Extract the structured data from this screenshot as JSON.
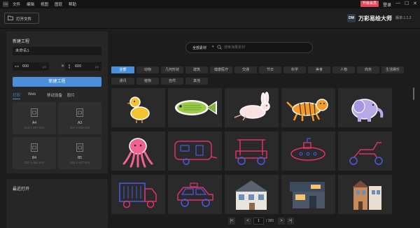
{
  "menubar": {
    "logo": "DM",
    "items": [
      "文件",
      "编辑",
      "视图",
      "图层",
      "帮助"
    ],
    "pro_badge": "升级会员",
    "login": "登录",
    "window_controls": [
      "—",
      "☐",
      "✕"
    ]
  },
  "toolbar": {
    "open_label": "打开文件",
    "brand_logo": "DM",
    "brand_name": "万彩易绘大师",
    "version": "版本:1.1.2"
  },
  "new_project": {
    "title": "新建工程",
    "name_value": "未命名1",
    "width": {
      "value": "600",
      "unit": "px"
    },
    "height": {
      "value": "600",
      "unit": "px"
    },
    "link_symbol": "✕",
    "create_label": "新建工程",
    "preset_tabs": [
      "打印",
      "Web",
      "移动设备",
      "胶片"
    ],
    "active_preset_tab": 0,
    "presets": [
      {
        "name": "A4",
        "size": "210 x 297 mm"
      },
      {
        "name": "A3",
        "size": "297 x 420 mm"
      },
      {
        "name": "B4",
        "size": "257 x 364 mm"
      },
      {
        "name": "B5",
        "size": "182 x 257 mm"
      }
    ]
  },
  "recent": {
    "title": "最近打开"
  },
  "search": {
    "type_label": "全部素材",
    "placeholder": "搜索海量素材"
  },
  "categories": {
    "row1": [
      "全部",
      "动物",
      "几何形状",
      "建筑",
      "健康医疗",
      "交通",
      "节日",
      "科学",
      "美食",
      "人物",
      "商务",
      "生活娱乐"
    ],
    "row2": [
      "通讯",
      "植物",
      "自然",
      "其他"
    ],
    "active": "全部"
  },
  "gallery": {
    "tiles": [
      "duck-icon",
      "fish-icon",
      "rabbit-icon",
      "tiger-icon",
      "elephant-icon",
      "octopus-icon",
      "caravan-icon",
      "golf-cart-icon",
      "submarine-icon",
      "scooter-icon",
      "garbage-truck-icon",
      "taxi-icon",
      "house-icon",
      "modern-house-icon",
      "townhouse-icon"
    ],
    "colors": {
      "neon_pink": "#e0306a",
      "neon_blue": "#4a5ae0",
      "accent": "#4a8fd9"
    }
  },
  "pagination": {
    "prev_first": "|<",
    "prev": "<",
    "current": "1",
    "total": "/ 385",
    "next": ">",
    "last": ">|"
  }
}
